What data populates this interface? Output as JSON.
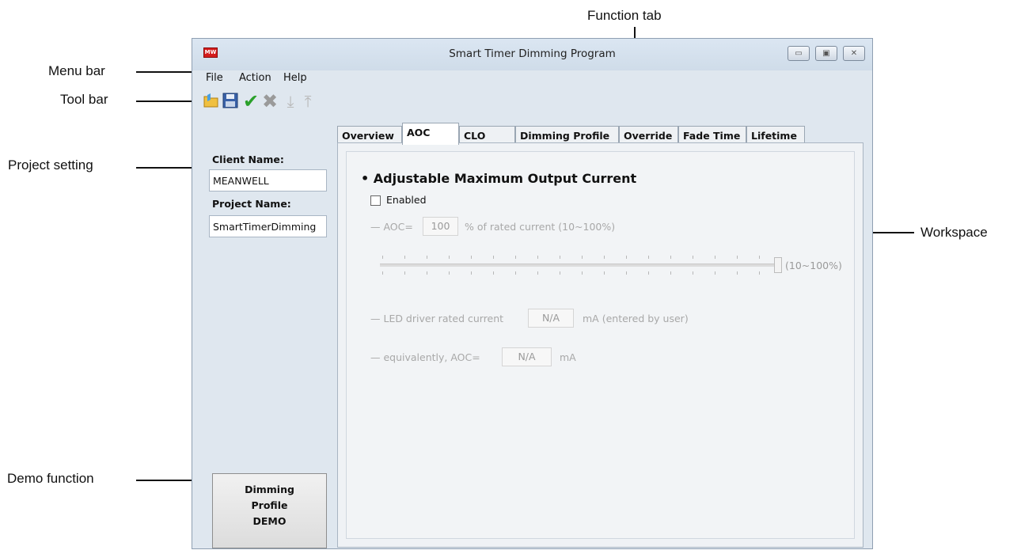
{
  "annotations": {
    "function_tab": "Function tab",
    "menu_bar": "Menu bar",
    "tool_bar": "Tool bar",
    "project_setting": "Project setting",
    "workspace": "Workspace",
    "demo_function": "Demo function"
  },
  "window": {
    "title": "Smart Timer Dimming Program",
    "logo_text": "MW",
    "controls": [
      "minimize-icon",
      "maximize-icon",
      "close-icon"
    ]
  },
  "menu": {
    "items": [
      "File",
      "Action",
      "Help"
    ]
  },
  "toolbar": {
    "icons": [
      "open-folder-icon",
      "save-icon",
      "checkmark-icon",
      "cross-icon",
      "import-icon",
      "export-icon"
    ]
  },
  "project": {
    "client_label": "Client Name:",
    "client_value": "MEANWELL",
    "project_label": "Project Name:",
    "project_value": "SmartTimerDimming"
  },
  "demo_button": {
    "line1": "Dimming",
    "line2": "Profile",
    "line3": "DEMO"
  },
  "tabs": [
    {
      "label": "Overview",
      "active": false
    },
    {
      "label": "AOC",
      "active": true
    },
    {
      "label": "CLO",
      "active": false
    },
    {
      "label": "Dimming Profile",
      "active": false
    },
    {
      "label": "Override",
      "active": false
    },
    {
      "label": "Fade Time",
      "active": false
    },
    {
      "label": "Lifetime",
      "active": false
    }
  ],
  "aoc": {
    "title": "• Adjustable Maximum Output Current",
    "enabled_label": "Enabled",
    "enabled": false,
    "aoc_prefix": "— AOC=",
    "aoc_value": "100",
    "aoc_suffix": "% of rated current (10~100%)",
    "slider_value_percent": 100,
    "slider_range_label": "(10~100%)",
    "rated_prefix": "— LED driver rated current",
    "rated_value": "N/A",
    "rated_suffix": "mA (entered by user)",
    "equiv_prefix": "— equivalently, AOC=",
    "equiv_value": "N/A",
    "equiv_suffix": "mA"
  }
}
